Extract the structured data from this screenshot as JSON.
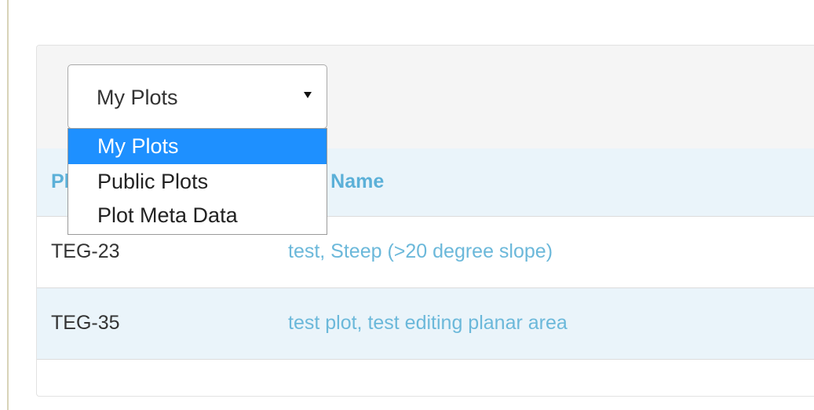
{
  "plot_source_select": {
    "selected": "My Plots",
    "options": [
      "My Plots",
      "Public Plots",
      "Plot Meta Data"
    ]
  },
  "table": {
    "headers": [
      "Plot ID",
      "Plot Name"
    ],
    "rows": [
      {
        "id": "TEG-23",
        "name": "test, Steep (>20 degree slope)"
      },
      {
        "id": "TEG-35",
        "name": "test plot, test editing planar area"
      }
    ]
  },
  "colors": {
    "link": "#6bb8da",
    "header_text": "#5bb0d8",
    "highlight": "#1e90ff",
    "stripe": "#eaf4fa"
  }
}
